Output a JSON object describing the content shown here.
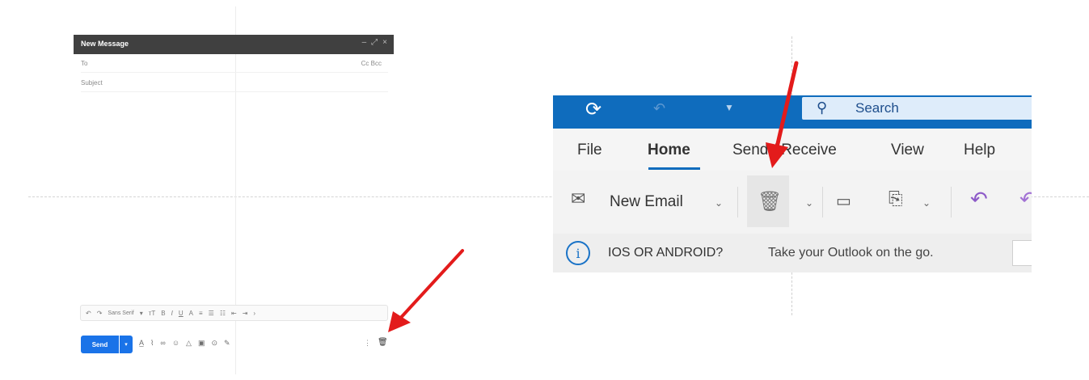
{
  "gmail": {
    "title": "New Message",
    "titlebar_icons": [
      "minimize-icon",
      "expand-icon",
      "close-icon"
    ],
    "to_label": "To",
    "cc_bcc_label": "Cc Bcc",
    "subject_label": "Subject",
    "format_font": "Sans Serif",
    "send_label": "Send"
  },
  "outlook": {
    "search_label": "Search",
    "menu": [
      "File",
      "Home",
      "Send / Receive",
      "View",
      "Help"
    ],
    "active_tab": "Home",
    "new_email_label": "New Email",
    "info_title": "IOS OR ANDROID?",
    "info_message": "Take your Outlook on the go.",
    "icons": [
      "sync-icon",
      "undo-icon",
      "search-icon",
      "new-email-icon",
      "delete-icon",
      "archive-icon",
      "move-icon",
      "reply-icon",
      "reply-all-icon",
      "info-icon"
    ]
  },
  "colors": {
    "outlook_blue": "#0f6cbd",
    "gmail_send": "#1a73e8",
    "annotation_arrow": "#e31b1b"
  }
}
